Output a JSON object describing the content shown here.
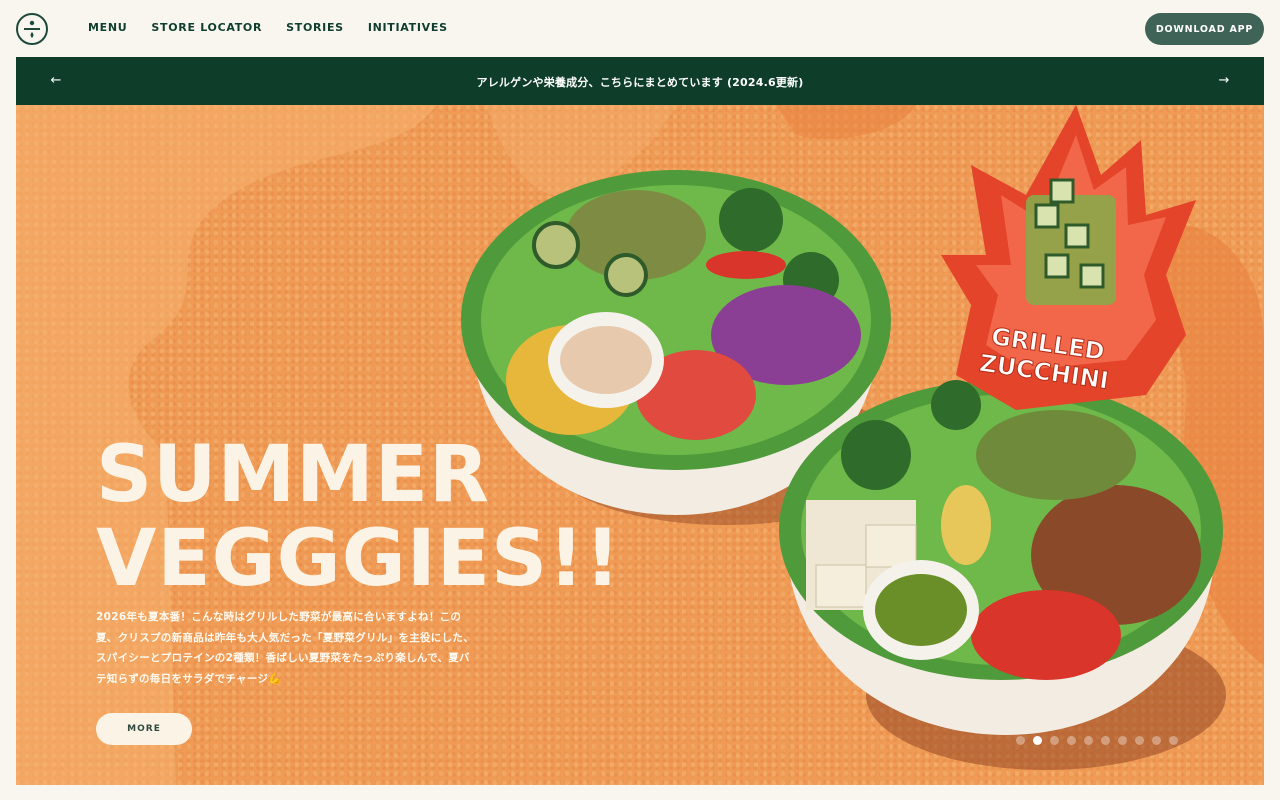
{
  "header": {
    "nav": [
      {
        "label": "MENU"
      },
      {
        "label": "STORE LOCATOR"
      },
      {
        "label": "STORIES"
      },
      {
        "label": "INITIATIVES"
      }
    ],
    "download_label": "DOWNLOAD  APP"
  },
  "announcement": {
    "text": "アレルゲンや栄養成分、こちらにまとめています (2024.6更新)",
    "prev_icon": "arrow-left-icon",
    "next_icon": "arrow-right-icon"
  },
  "hero": {
    "title_line1": "SUMMER",
    "title_line2": "VEGGGIES!!",
    "description": "2026年も夏本番！こんな時はグリルした野菜が最高に合いますよね！この夏、クリスプの新商品は昨年も大人気だった「夏野菜グリル」を主役にした、スパイシーとプロテインの2種類！香ばしい夏野菜をたっぷり楽しんで、夏バテ知らずの毎日をサラダでチャージ💪",
    "more_label": "MORE",
    "badge_line1": "GRILLED",
    "badge_line2": "ZUCCHINI",
    "slide_count": 10,
    "active_slide": 2
  },
  "colors": {
    "brand_green": "#0e3d2a",
    "hero_orange": "#ef9a55",
    "badge_red": "#e3442a"
  }
}
